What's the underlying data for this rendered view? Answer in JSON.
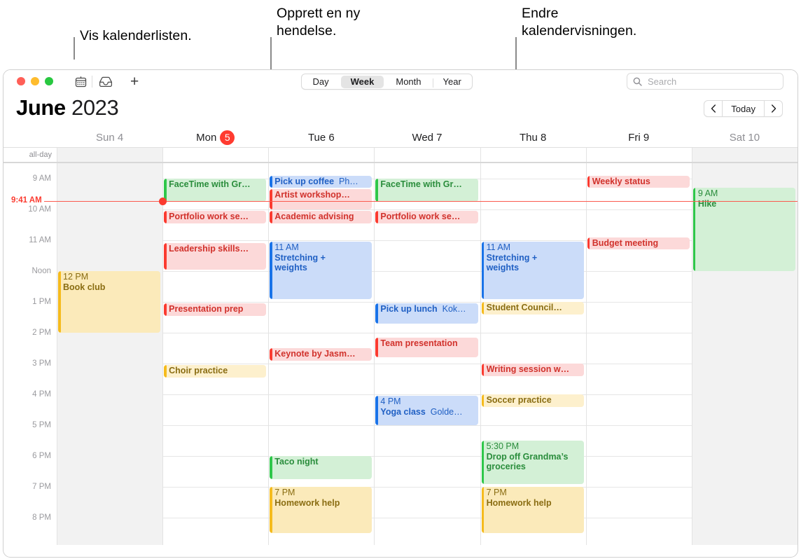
{
  "callouts": [
    {
      "text": "Vis kalenderlisten."
    },
    {
      "text": "Opprett en ny\nhendelse."
    },
    {
      "text": "Endre\nkalendervisningen."
    }
  ],
  "toolbar": {
    "calendar_list_icon": "calendar-icon",
    "inbox_icon": "inbox-icon",
    "new_event_label": "+",
    "views": [
      {
        "label": "Day",
        "active": false
      },
      {
        "label": "Week",
        "active": true
      },
      {
        "label": "Month",
        "active": false
      },
      {
        "label": "Year",
        "active": false
      }
    ],
    "search_placeholder": "Search",
    "search_value": ""
  },
  "header": {
    "month": "June",
    "year": "2023",
    "prev_label": "‹",
    "today_label": "Today",
    "next_label": "›"
  },
  "allday_label": "all-day",
  "days": [
    {
      "name": "Sun 4",
      "weekend": true,
      "today": false
    },
    {
      "name": "Mon",
      "weekend": false,
      "today": true,
      "badge": "5"
    },
    {
      "name": "Tue 6",
      "weekend": false,
      "today": false
    },
    {
      "name": "Wed 7",
      "weekend": false,
      "today": false
    },
    {
      "name": "Thu 8",
      "weekend": false,
      "today": false
    },
    {
      "name": "Fri 9",
      "weekend": false,
      "today": false
    },
    {
      "name": "Sat 10",
      "weekend": true,
      "today": false
    }
  ],
  "time_labels": [
    "9 AM",
    "10 AM",
    "11 AM",
    "Noon",
    "1 PM",
    "2 PM",
    "3 PM",
    "4 PM",
    "5 PM",
    "6 PM",
    "7 PM",
    "8 PM"
  ],
  "now": {
    "label": "9:41 AM",
    "day_index": 1
  },
  "colors": {
    "red": "#fb3b30",
    "green": "#2fc74a",
    "blue": "#1a73e8",
    "yellow": "#f5bb1d",
    "today_badge": "#ff3b30",
    "now_line": "#fb5a4f"
  },
  "events": [
    {
      "day": 0,
      "color": "yellow",
      "time": "12 PM",
      "title": "Book club",
      "loc": "",
      "start": 12.0,
      "end": 14.0,
      "layout": "stack"
    },
    {
      "day": 1,
      "color": "green",
      "time": "",
      "title": "FaceTime with Gr…",
      "loc": "",
      "start": 9.0,
      "end": 9.75,
      "layout": "inline"
    },
    {
      "day": 1,
      "color": "red",
      "time": "",
      "title": "Portfolio work se…",
      "loc": "",
      "start": 10.05,
      "end": 10.45,
      "layout": "inline"
    },
    {
      "day": 1,
      "color": "red",
      "time": "",
      "title": "Leadership skills…",
      "loc": "",
      "start": 11.1,
      "end": 11.95,
      "layout": "inline"
    },
    {
      "day": 1,
      "color": "red",
      "time": "",
      "title": "Presentation prep",
      "loc": "",
      "start": 13.05,
      "end": 13.45,
      "layout": "inline"
    },
    {
      "day": 1,
      "color": "yellow-l",
      "time": "",
      "title": "Choir practice",
      "loc": "",
      "start": 15.05,
      "end": 15.45,
      "layout": "inline"
    },
    {
      "day": 2,
      "color": "blue",
      "time": "",
      "title": "Pick up coffee",
      "loc": "Ph…",
      "start": 8.9,
      "end": 9.3,
      "layout": "inline"
    },
    {
      "day": 2,
      "color": "red",
      "time": "",
      "title": "Artist workshop…",
      "loc": "",
      "start": 9.35,
      "end": 10.0,
      "layout": "inline"
    },
    {
      "day": 2,
      "color": "red",
      "time": "",
      "title": "Academic advising",
      "loc": "",
      "start": 10.05,
      "end": 10.45,
      "layout": "inline"
    },
    {
      "day": 2,
      "color": "blue",
      "time": "11 AM",
      "title": "Stretching +\nweights",
      "loc": "",
      "start": 11.05,
      "end": 12.9,
      "layout": "stack"
    },
    {
      "day": 2,
      "color": "red",
      "time": "",
      "title": "Keynote by Jasm…",
      "loc": "",
      "start": 14.5,
      "end": 14.9,
      "layout": "inline"
    },
    {
      "day": 2,
      "color": "green",
      "time": "",
      "title": "Taco night",
      "loc": "",
      "start": 18.0,
      "end": 18.75,
      "layout": "inline"
    },
    {
      "day": 2,
      "color": "yellow",
      "time": "7 PM",
      "title": "Homework help",
      "loc": "",
      "start": 19.0,
      "end": 20.5,
      "layout": "stack"
    },
    {
      "day": 3,
      "color": "green",
      "time": "",
      "title": "FaceTime with Gr…",
      "loc": "",
      "start": 9.0,
      "end": 9.75,
      "layout": "inline"
    },
    {
      "day": 3,
      "color": "red",
      "time": "",
      "title": "Portfolio work se…",
      "loc": "",
      "start": 10.05,
      "end": 10.45,
      "layout": "inline"
    },
    {
      "day": 3,
      "color": "blue",
      "time": "",
      "title": "Pick up lunch",
      "loc": "Kok…",
      "start": 13.05,
      "end": 13.7,
      "layout": "inline"
    },
    {
      "day": 3,
      "color": "red",
      "time": "",
      "title": "Team presentation",
      "loc": "",
      "start": 14.15,
      "end": 14.8,
      "layout": "inline"
    },
    {
      "day": 3,
      "color": "blue",
      "time": "4 PM",
      "title": "Yoga class",
      "loc": "Golde…",
      "start": 16.05,
      "end": 17.0,
      "layout": "inline-time"
    },
    {
      "day": 4,
      "color": "blue",
      "time": "11 AM",
      "title": "Stretching +\nweights",
      "loc": "",
      "start": 11.05,
      "end": 12.9,
      "layout": "stack"
    },
    {
      "day": 4,
      "color": "yellow-l",
      "time": "",
      "title": "Student Council…",
      "loc": "",
      "start": 13.0,
      "end": 13.4,
      "layout": "inline"
    },
    {
      "day": 4,
      "color": "red",
      "time": "",
      "title": "Writing session w…",
      "loc": "",
      "start": 15.0,
      "end": 15.4,
      "layout": "inline"
    },
    {
      "day": 4,
      "color": "yellow-l",
      "time": "",
      "title": "Soccer practice",
      "loc": "",
      "start": 16.0,
      "end": 16.4,
      "layout": "inline"
    },
    {
      "day": 4,
      "color": "green",
      "time": "5:30 PM",
      "title": "Drop off Grandma’s\ngroceries",
      "loc": "",
      "start": 17.5,
      "end": 18.9,
      "layout": "stack"
    },
    {
      "day": 4,
      "color": "yellow",
      "time": "7 PM",
      "title": "Homework help",
      "loc": "",
      "start": 19.0,
      "end": 20.5,
      "layout": "stack"
    },
    {
      "day": 5,
      "color": "red",
      "time": "",
      "title": "Weekly status",
      "loc": "",
      "start": 8.9,
      "end": 9.3,
      "layout": "inline"
    },
    {
      "day": 5,
      "color": "red",
      "time": "",
      "title": "Budget meeting",
      "loc": "",
      "start": 10.9,
      "end": 11.3,
      "layout": "inline"
    },
    {
      "day": 6,
      "color": "green",
      "time": "9 AM",
      "title": "Hike",
      "loc": "",
      "start": 9.3,
      "end": 12.0,
      "layout": "stack"
    }
  ]
}
